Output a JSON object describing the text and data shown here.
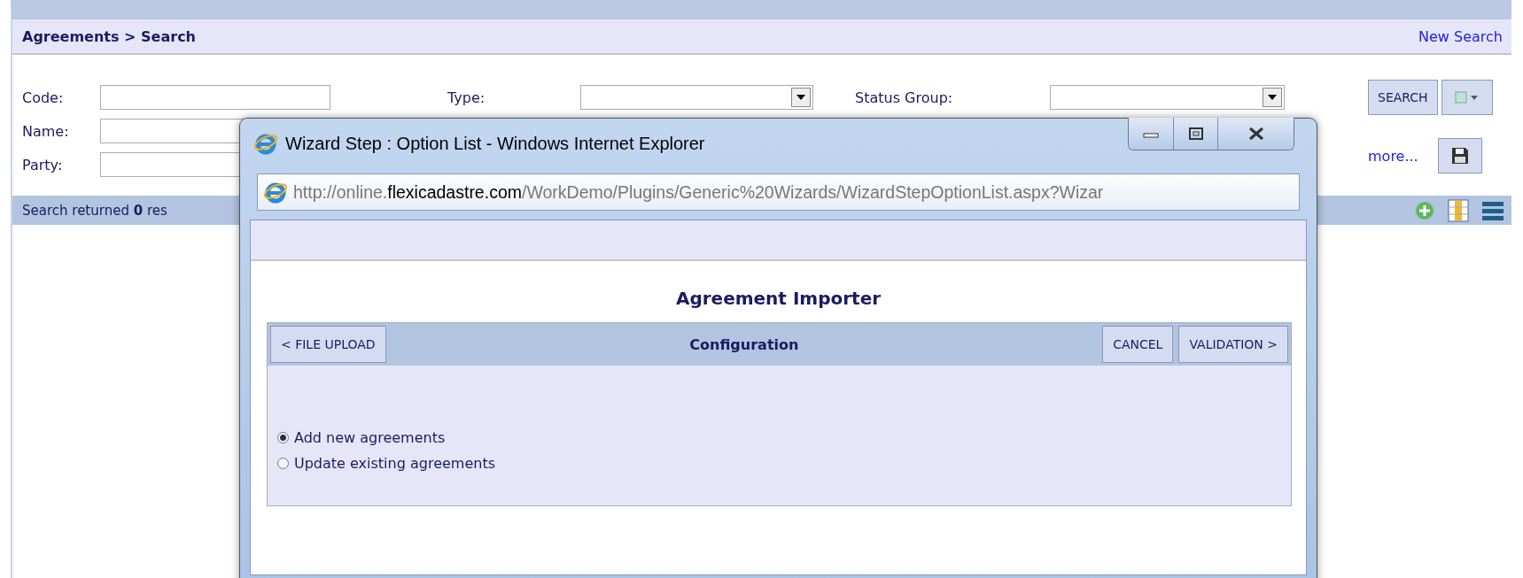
{
  "page": {
    "breadcrumb": "Agreements > Search",
    "new_search_link": "New Search"
  },
  "filter_columns": [
    {
      "fields": [
        {
          "label": "Code:",
          "kind": "text"
        },
        {
          "label": "Name:",
          "kind": "text"
        },
        {
          "label": "Party:",
          "kind": "text"
        }
      ]
    },
    {
      "fields": [
        {
          "label": "Type:",
          "kind": "select"
        }
      ]
    },
    {
      "fields": [
        {
          "label": "Status Group:",
          "kind": "select"
        }
      ]
    }
  ],
  "search_button": "SEARCH",
  "more_link": "more...",
  "results_text": "Search returned **0** res",
  "dialog": {
    "title": "Wizard Step : Option List - Windows Internet Explorer",
    "url_prefix": "http://online.",
    "url_domain": "flexicadastre.com",
    "url_path": "/WorkDemo/Plugins/Generic%20Wizards/WizardStepOptionList.aspx?Wizar",
    "heading": "Agreement Importer",
    "step": "Configuration",
    "back_button": "< FILE UPLOAD",
    "cancel_button": "CANCEL",
    "next_button": "VALIDATION >",
    "options": [
      {
        "label": "Add new agreements",
        "selected": true
      },
      {
        "label": "Update existing agreements",
        "selected": false
      }
    ]
  }
}
